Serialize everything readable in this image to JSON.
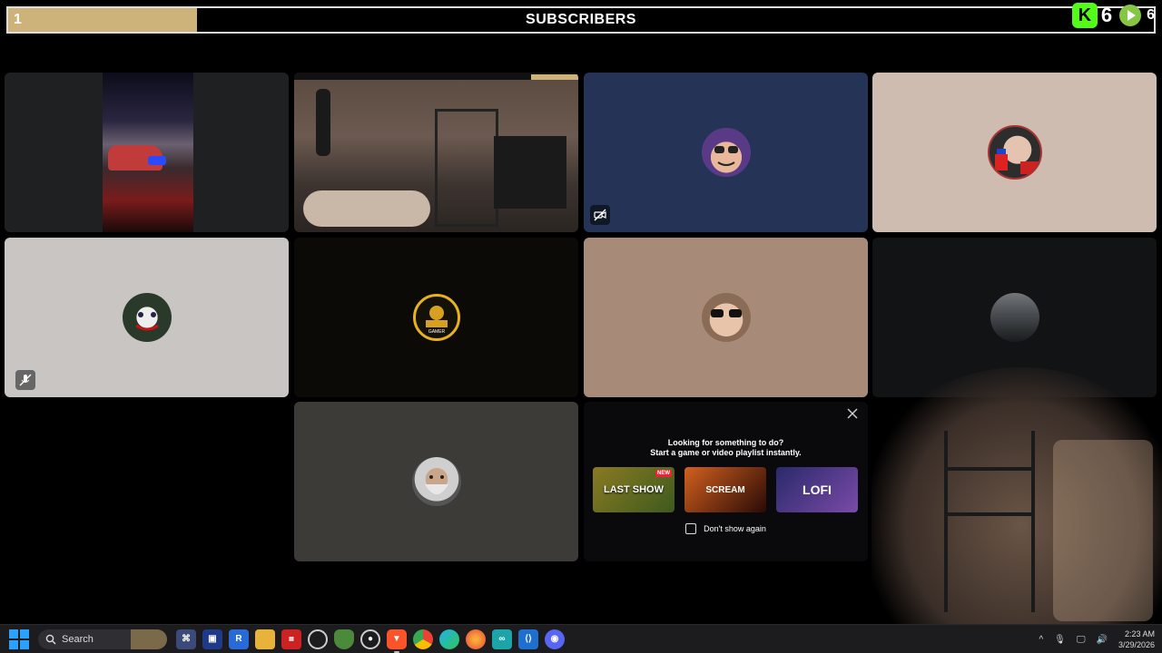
{
  "sub_goal": {
    "count": "1",
    "title": "SUBSCRIBERS",
    "progress_fraction": 0.165,
    "fill_color": "#cdb27a"
  },
  "platforms": [
    {
      "name_icon": "kick-icon",
      "value": "6"
    },
    {
      "name_icon": "rumble-icon",
      "value": "6"
    }
  ],
  "tiles": [
    {
      "kind": "video",
      "scene": "night-street",
      "bg": "#1f2022"
    },
    {
      "kind": "video",
      "scene": "bedroom-cam",
      "bg": "#3a3330"
    },
    {
      "kind": "avatar",
      "bg": "#253456",
      "icon": "sunglasses-face-avatar"
    },
    {
      "kind": "avatar",
      "bg": "#cdbcaf",
      "icon": "mario-avatar"
    },
    {
      "kind": "avatar",
      "bg": "#c9c5c3",
      "icon": "joker-avatar"
    },
    {
      "kind": "avatar",
      "bg": "#0c0a06",
      "icon": "gamer-logo-avatar"
    },
    {
      "kind": "avatar",
      "bg": "#a88a79",
      "icon": "sunglasses-man-avatar"
    },
    {
      "kind": "avatar",
      "bg": "#121314",
      "icon": "car-avatar"
    },
    {
      "kind": "avatar",
      "bg": "#3c3b38",
      "icon": "old-man-avatar"
    }
  ],
  "activity": {
    "line1": "Looking for something to do?",
    "line2": "Start a game or video playlist instantly.",
    "items": [
      {
        "label": "LAST SHOW",
        "badge": "NEW",
        "bg": "#6a5a1e"
      },
      {
        "label": "SCREAM",
        "badge": "",
        "bg": "#7a1e10"
      },
      {
        "label": "LOFI",
        "badge": "",
        "bg": "#3a3a8a"
      }
    ],
    "dont_show": "Don't show again"
  },
  "taskbar": {
    "search_placeholder": "Search",
    "time": "2:23 AM",
    "date": "3/29/2026"
  }
}
